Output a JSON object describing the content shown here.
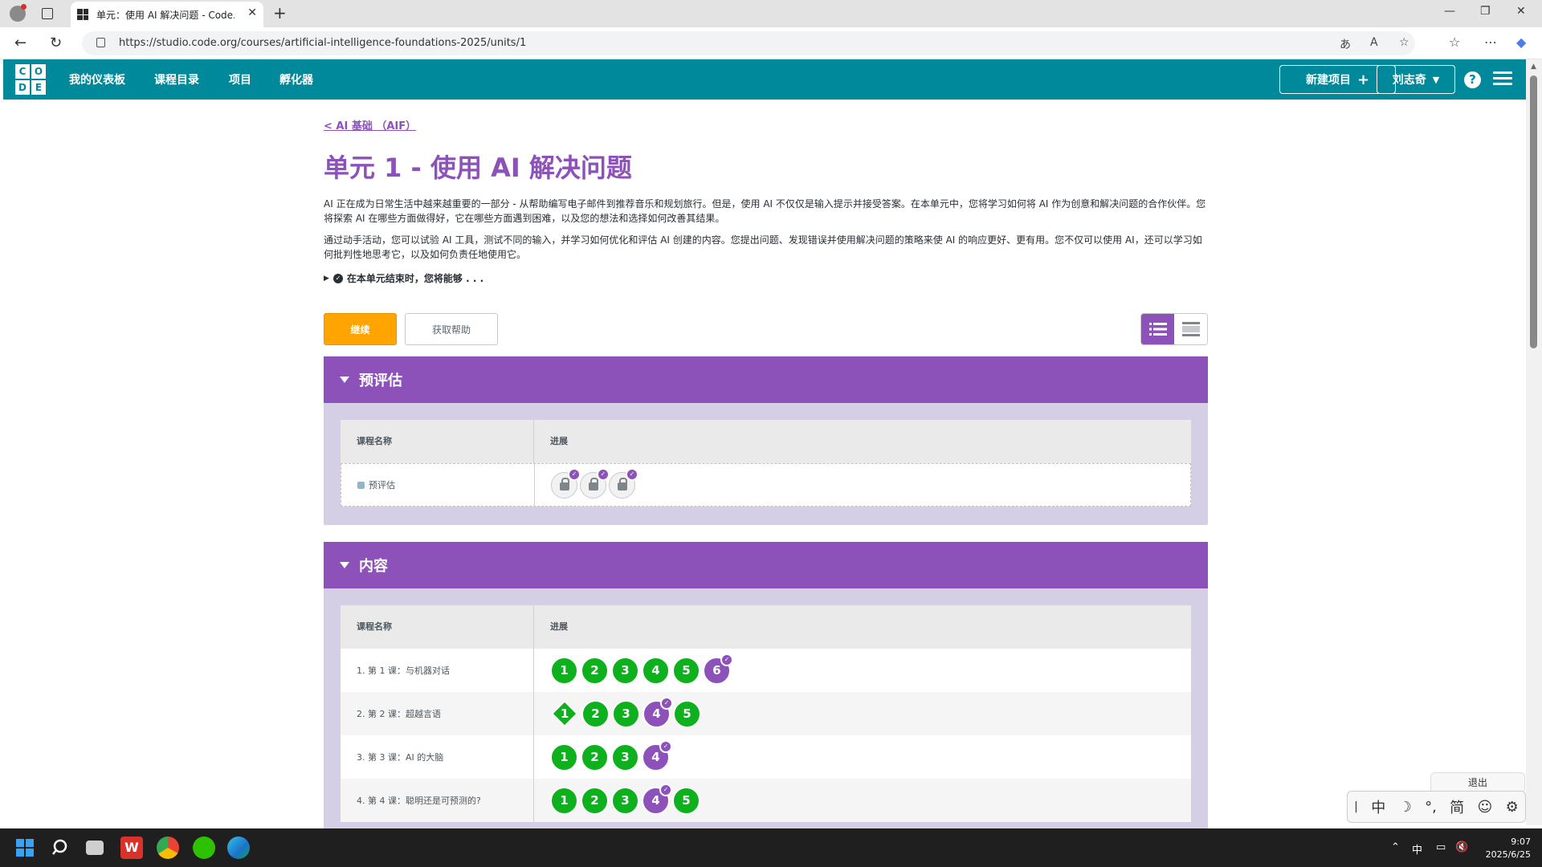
{
  "browser": {
    "tab_title": "单元：使用 AI 解决问题 - Code.org",
    "url": "https://studio.code.org/courses/artificial-intelligence-foundations-2025/units/1"
  },
  "header": {
    "logo_letters": [
      "C",
      "O",
      "D",
      "E"
    ],
    "nav": [
      "我的仪表板",
      "课程目录",
      "项目",
      "孵化器"
    ],
    "new_project": "新建项目",
    "user_name": "刘志奇",
    "help": "?"
  },
  "main": {
    "back_link": "< AI 基础 （AIF）",
    "title": "单元 1 - 使用 AI 解决问题",
    "paragraph1": "AI 正在成为日常生活中越来越重要的一部分 - 从帮助编写电子邮件到推荐音乐和规划旅行。但是，使用 AI 不仅仅是输入提示并接受答案。在本单元中，您将学习如何将 AI 作为创意和解决问题的合作伙伴。您将探索 AI 在哪些方面做得好，它在哪些方面遇到困难，以及您的想法和选择如何改善其结果。",
    "paragraph2": "通过动手活动，您可以试验 AI 工具，测试不同的输入，并学习如何优化和评估 AI 创建的内容。您提出问题、发现错误并使用解决问题的策略来使 AI 的响应更好、更有用。您不仅可以使用 AI，还可以学习如何批判性地思考它，以及如何负责任地使用它。",
    "goals_label": "在本单元结束时，您将能够 . . .",
    "continue_button": "继续",
    "help_button": "获取帮助"
  },
  "sections": [
    {
      "title": "预评估",
      "col_name": "课程名称",
      "col_progress": "进展",
      "rows": [
        {
          "name": "预评估",
          "locked": true,
          "bubbles": [
            {
              "label": "",
              "type": "lock",
              "check": true
            },
            {
              "label": "",
              "type": "lock",
              "check": true
            },
            {
              "label": "",
              "type": "lock",
              "check": true
            }
          ]
        }
      ]
    },
    {
      "title": "内容",
      "col_name": "课程名称",
      "col_progress": "进展",
      "rows": [
        {
          "name": "1. 第 1 课：与机器对话",
          "bubbles": [
            {
              "label": "1",
              "type": "green"
            },
            {
              "label": "2",
              "type": "green"
            },
            {
              "label": "3",
              "type": "green"
            },
            {
              "label": "4",
              "type": "green"
            },
            {
              "label": "5",
              "type": "green"
            },
            {
              "label": "6",
              "type": "purple",
              "check": true
            }
          ]
        },
        {
          "name": "2. 第 2 课：超越言语",
          "bubbles": [
            {
              "label": "1",
              "type": "diamond"
            },
            {
              "label": "2",
              "type": "green"
            },
            {
              "label": "3",
              "type": "green"
            },
            {
              "label": "4",
              "type": "purple",
              "check": true
            },
            {
              "label": "5",
              "type": "green"
            }
          ]
        },
        {
          "name": "3. 第 3 课：AI 的大脑",
          "bubbles": [
            {
              "label": "1",
              "type": "green"
            },
            {
              "label": "2",
              "type": "green"
            },
            {
              "label": "3",
              "type": "green"
            },
            {
              "label": "4",
              "type": "purple",
              "check": true
            }
          ]
        },
        {
          "name": "4. 第 4 课：聪明还是可预测的?",
          "bubbles": [
            {
              "label": "1",
              "type": "green"
            },
            {
              "label": "2",
              "type": "green"
            },
            {
              "label": "3",
              "type": "green"
            },
            {
              "label": "4",
              "type": "purple",
              "check": true
            },
            {
              "label": "5",
              "type": "green"
            }
          ]
        }
      ]
    }
  ],
  "overlay": {
    "signout": "退出",
    "ime": [
      "中",
      "☽",
      "°,",
      "简",
      "☺",
      "⚙"
    ]
  },
  "taskbar": {
    "tray_ime": "中",
    "time": "9:07",
    "date": "2025/6/25"
  },
  "colors": {
    "brand_teal": "#00899b",
    "purple": "#8c52ba",
    "green": "#0eb01d",
    "orange": "#ffa400"
  }
}
